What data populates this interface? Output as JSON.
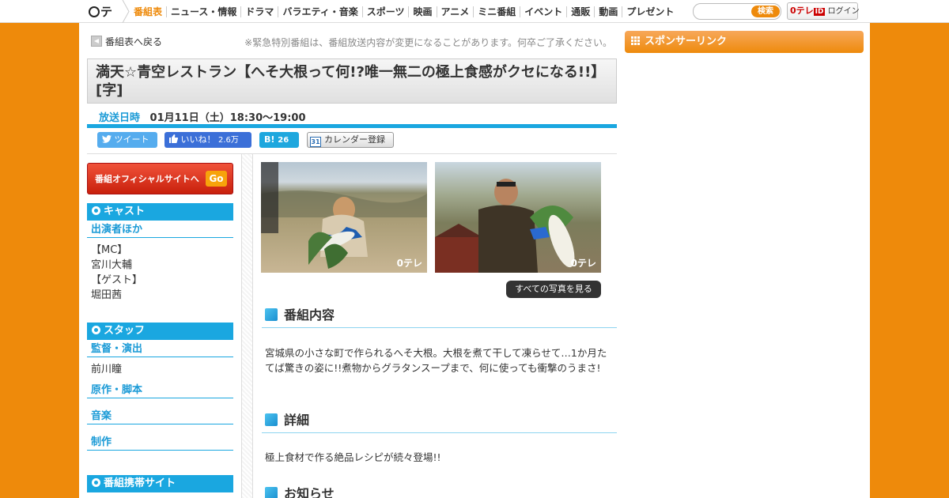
{
  "nav": {
    "logo": "テレ",
    "items": [
      "番組表",
      "ニュース・情報",
      "ドラマ",
      "バラエティ・音楽",
      "スポーツ",
      "映画",
      "アニメ",
      "ミニ番組",
      "イベント",
      "通販",
      "動画",
      "プレゼント"
    ],
    "search_button": "検索",
    "login_id": "ID",
    "login_label": "ログイン"
  },
  "page": {
    "back_link": "番組表へ戻る",
    "notice": "※緊急特別番組は、番組放送内容が変更になることがあります。何卒ご了承ください。",
    "title": "満天☆青空レストラン【へそ大根って何!?唯一無二の極上食感がクセになる!!】[字]",
    "broadcast_label": "放送日時",
    "broadcast_value": "01月11日（土）18:30～19:00"
  },
  "share": {
    "tweet": "ツイート",
    "like": "いいね！",
    "like_count": "2.6万",
    "hatena": "B!",
    "hatena_count": "26",
    "calendar": "カレンダー登録",
    "calendar_icon_text": "31"
  },
  "sidebar": {
    "official_button": "番組オフィシャルサイトへ",
    "official_go": "Go",
    "cast_header": "キャスト",
    "cast_sub": "出演者ほか",
    "cast_lines": [
      "【MC】",
      "宮川大輔",
      "【ゲスト】",
      "堀田茜"
    ],
    "staff_header": "スタッフ",
    "director_sub": "監督・演出",
    "director_lines": [
      "前川瞳"
    ],
    "writer_sub": "原作・脚本",
    "music_sub": "音楽",
    "production_sub": "制作",
    "mobile_header": "番組携帯サイト"
  },
  "main": {
    "photo_watermark": "テレ",
    "see_all": "すべての写真を見る",
    "content_heading": "番組内容",
    "content_text": "宮城県の小さな町で作られるへそ大根。大根を煮て干して凍らせて…1か月たてば驚きの姿に!!煮物からグラタンスープまで、何に使っても衝撃のうまさ!",
    "detail_heading": "詳細",
    "detail_text": "極上食材で作る絶品レシピが続々登場!!",
    "info_heading": "お知らせ"
  },
  "right": {
    "sponsor_header": "スポンサーリンク"
  },
  "colors": {
    "brand_orange": "#ee8a0b",
    "accent_blue": "#1aa7e0"
  }
}
